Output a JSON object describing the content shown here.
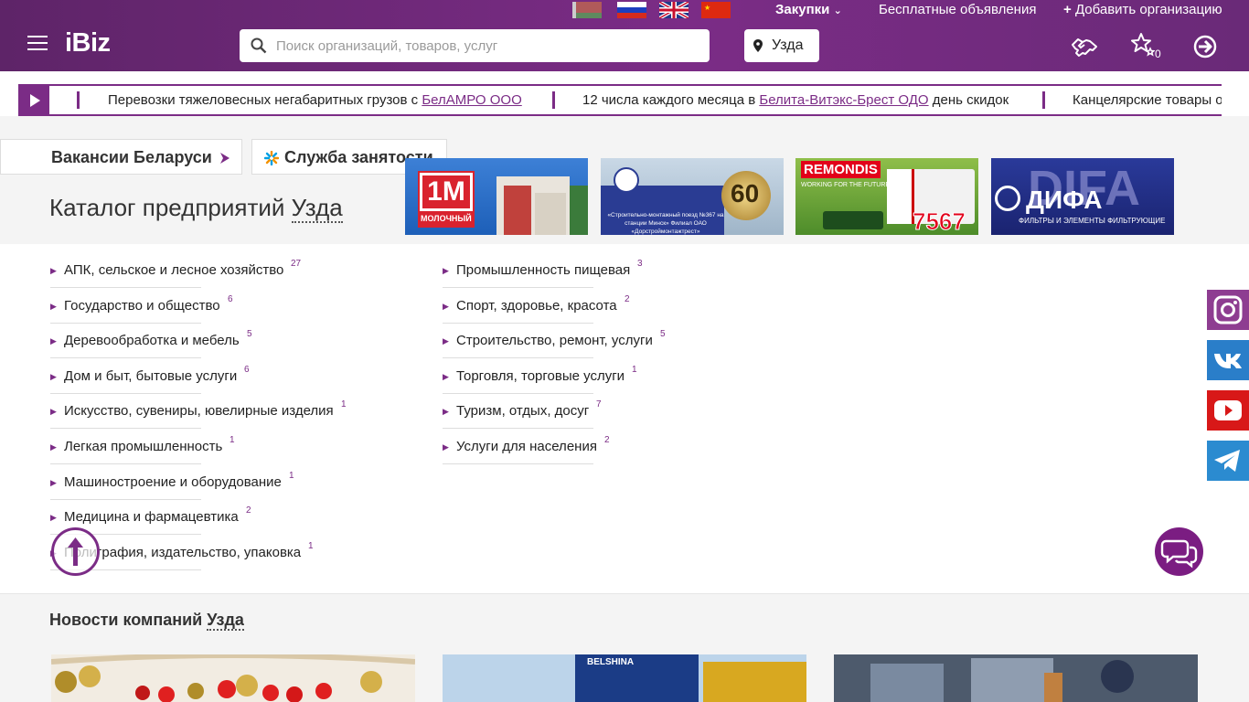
{
  "header": {
    "logo": "iBiz",
    "zakupki": "Закупки",
    "free_ads": "Бесплатные объявления",
    "add_org": "Добавить организацию",
    "search_placeholder": "Поиск организаций, товаров, услуг",
    "city": "Узда",
    "favorites_count": "0"
  },
  "ticker": [
    {
      "before": "Перевозки тяжеловесных негабаритных грузов с ",
      "link": "БелАМРО ООО",
      "after": ""
    },
    {
      "before": "12 числа каждого месяца в ",
      "link": "Белита-Витэкс-Брест ОДО",
      "after": " день скидок"
    },
    {
      "before": "Канцелярские товары оптом",
      "link": "",
      "after": ""
    }
  ],
  "pills": {
    "vacancies": "Вакансии Беларуси",
    "employment": "Служба занятости"
  },
  "catalog": {
    "title_prefix": "Каталог предприятий ",
    "city": "Узда"
  },
  "banners": [
    {
      "text": "1M",
      "sub": "МОЛОЧНЫЙ"
    },
    {
      "text": "60",
      "sub": "«Строительно-монтажный поезд №367 на станции Минск» Филиал ОАО «Дорстроймонтажтрест»"
    },
    {
      "text": "REMONDIS",
      "sub": "WORKING FOR THE FUTURE",
      "num": "7567"
    },
    {
      "text": "ДИФА",
      "sub": "ФИЛЬТРЫ И ЭЛЕМЕНТЫ ФИЛЬТРУЮЩИЕ"
    }
  ],
  "categories_left": [
    {
      "label": "АПК, сельское и лесное хозяйство",
      "count": "27"
    },
    {
      "label": "Государство и общество",
      "count": "6"
    },
    {
      "label": "Деревообработка и мебель",
      "count": "5"
    },
    {
      "label": "Дом и быт, бытовые услуги",
      "count": "6"
    },
    {
      "label": "Искусство, сувениры, ювелирные изделия",
      "count": "1"
    },
    {
      "label": "Легкая промышленность",
      "count": "1"
    },
    {
      "label": "Машиностроение и оборудование",
      "count": "1"
    },
    {
      "label": "Медицина и фармацевтика",
      "count": "2"
    },
    {
      "label": "Полиграфия, издательство, упаковка",
      "count": "1"
    }
  ],
  "categories_right": [
    {
      "label": "Промышленность пищевая",
      "count": "3"
    },
    {
      "label": "Спорт, здоровье, красота",
      "count": "2"
    },
    {
      "label": "Строительство, ремонт, услуги",
      "count": "5"
    },
    {
      "label": "Торговля, торговые услуги",
      "count": "1"
    },
    {
      "label": "Туризм, отдых, досуг",
      "count": "7"
    },
    {
      "label": "Услуги для населения",
      "count": "2"
    }
  ],
  "news": {
    "title_prefix": "Новости компаний ",
    "city": "Узда",
    "belshina": "BELSHINA"
  },
  "colors": {
    "brand": "#7b2c86",
    "brand_dark": "#5e2468"
  },
  "social": [
    "instagram-icon",
    "vk-icon",
    "youtube-icon",
    "telegram-icon"
  ]
}
